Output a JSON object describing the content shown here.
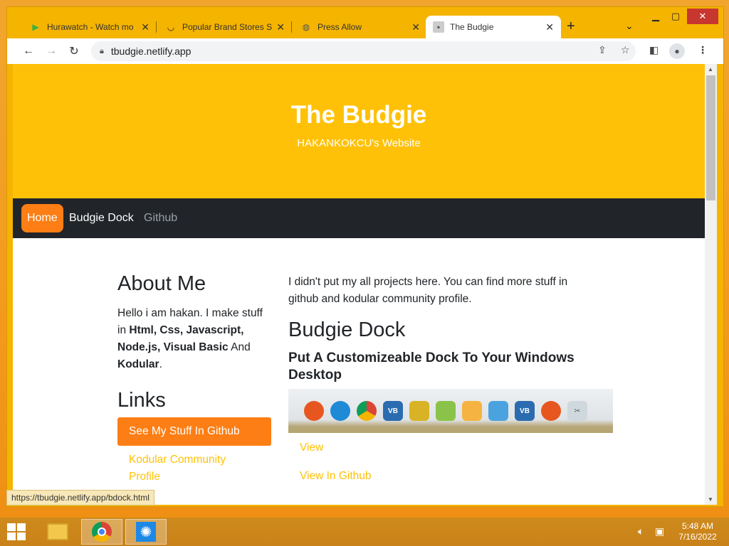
{
  "browser": {
    "tabs": [
      {
        "title": "Hurawatch - Watch mo",
        "icon": "play-icon"
      },
      {
        "title": "Popular Brand Stores Sa",
        "icon": "smile-icon"
      },
      {
        "title": "Press Allow",
        "icon": "globe-icon"
      },
      {
        "title": "The Budgie",
        "icon": "budgie-icon",
        "active": true
      }
    ],
    "url": "tbudgie.netlify.app",
    "status_url": "https://tbudgie.netlify.app/bdock.html"
  },
  "page": {
    "hero_title": "The Budgie",
    "hero_subtitle": "HAKANKOKCU's Website",
    "nav": [
      "Home",
      "Budgie Dock",
      "Github"
    ],
    "about": {
      "heading": "About Me",
      "line1": "Hello i am hakan. I make stuff",
      "line2_pre": "in ",
      "line2_bold": "Html, Css, Javascript,",
      "line3_bold": "Node.js, Visual Basic",
      "line3_post": " And",
      "line4_bold": "Kodular",
      "line4_post": "."
    },
    "links": {
      "heading": "Links",
      "button": "See My Stuff In Github",
      "kodular_1": "Kodular Community",
      "kodular_2": "Profile"
    },
    "intro_1": "I didn't put my all projects here. You can find more stuff in",
    "intro_2": "github and kodular community profile.",
    "project": {
      "heading": "Budgie Dock",
      "subheading_1": "Put A Customizeable Dock To Your Windows",
      "subheading_2": "Desktop",
      "view": "View",
      "view_github": "View In Github"
    }
  },
  "taskbar": {
    "time": "5:48 AM",
    "date": "7/16/2022"
  },
  "colors": {
    "hero": "#ffc107",
    "accent": "#fd7e14",
    "navbar": "#212529"
  }
}
